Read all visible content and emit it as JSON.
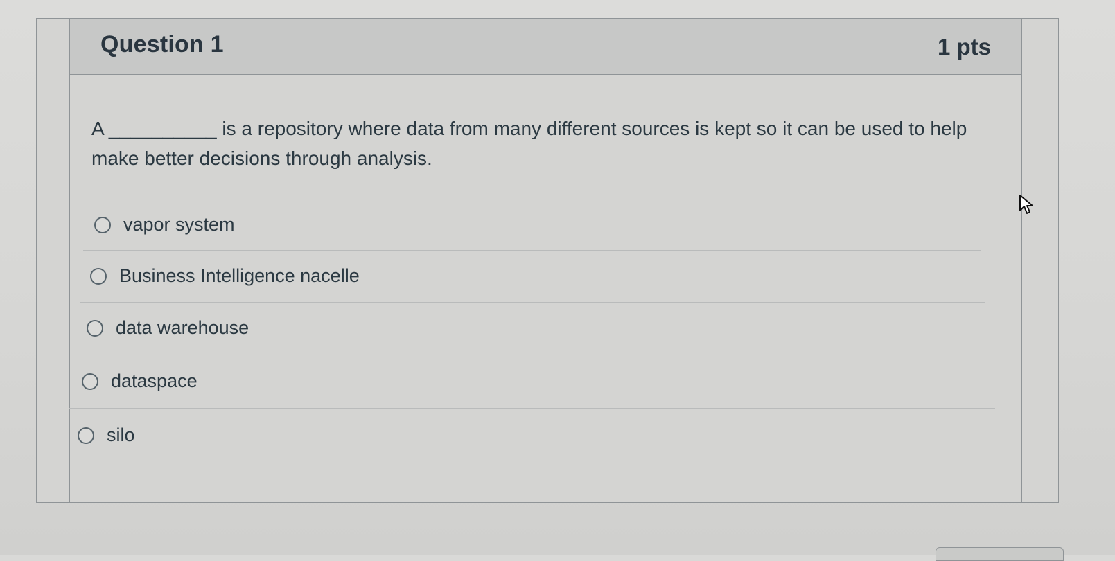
{
  "question": {
    "title": "Question 1",
    "points": "1 pts",
    "text": "A __________ is a repository where data from many different sources is kept so it can be used to help make better decisions through analysis."
  },
  "answers": [
    {
      "label": "vapor system",
      "selected": false
    },
    {
      "label": "Business Intelligence nacelle",
      "selected": false
    },
    {
      "label": "data warehouse",
      "selected": false
    },
    {
      "label": "dataspace",
      "selected": false
    },
    {
      "label": "silo",
      "selected": false
    }
  ],
  "icons": {
    "radio": "radio-button-icon",
    "cursor": "mouse-pointer-icon"
  },
  "colors": {
    "text": "#2b3942",
    "header_background": "#c7c8c7",
    "page_background": "#d9d9d7",
    "border": "#8f9497"
  }
}
